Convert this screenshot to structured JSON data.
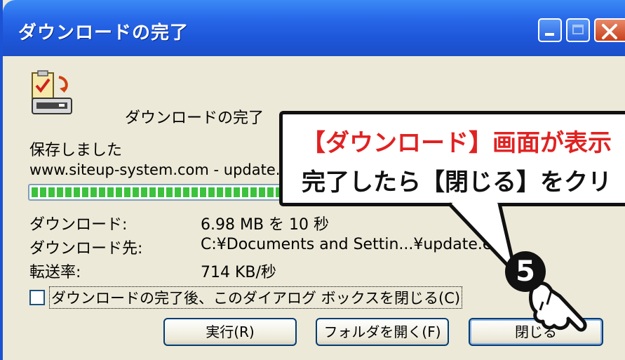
{
  "window": {
    "title": "ダウンロードの完了",
    "heading": "ダウンロードの完了",
    "status": "保存しました",
    "source": "www.siteup-system.com - update.",
    "progress": 1.0
  },
  "details": {
    "downloaded_label": "ダウンロード:",
    "downloaded_value": "6.98 MB を 10 秒",
    "destination_label": "ダウンロード先:",
    "destination_value": "C:¥Documents and Settin...¥update.exe",
    "rate_label": "転送率:",
    "rate_value": "714 KB/秒"
  },
  "checkbox": {
    "label": "ダウンロードの完了後、このダイアログ ボックスを閉じる(C)",
    "checked": false
  },
  "buttons": {
    "run": "実行(R)",
    "open_folder": "フォルダを開く(F)",
    "close": "閉じる"
  },
  "callout": {
    "line1": "【ダウンロード】画面が表示",
    "line2": "完了したら【閉じる】をクリ",
    "step": "5"
  },
  "colors": {
    "titlebar": "#1d56d8",
    "dialog_bg": "#ece9d8",
    "progress": "#3cc23c",
    "callout_highlight": "#e02222"
  }
}
